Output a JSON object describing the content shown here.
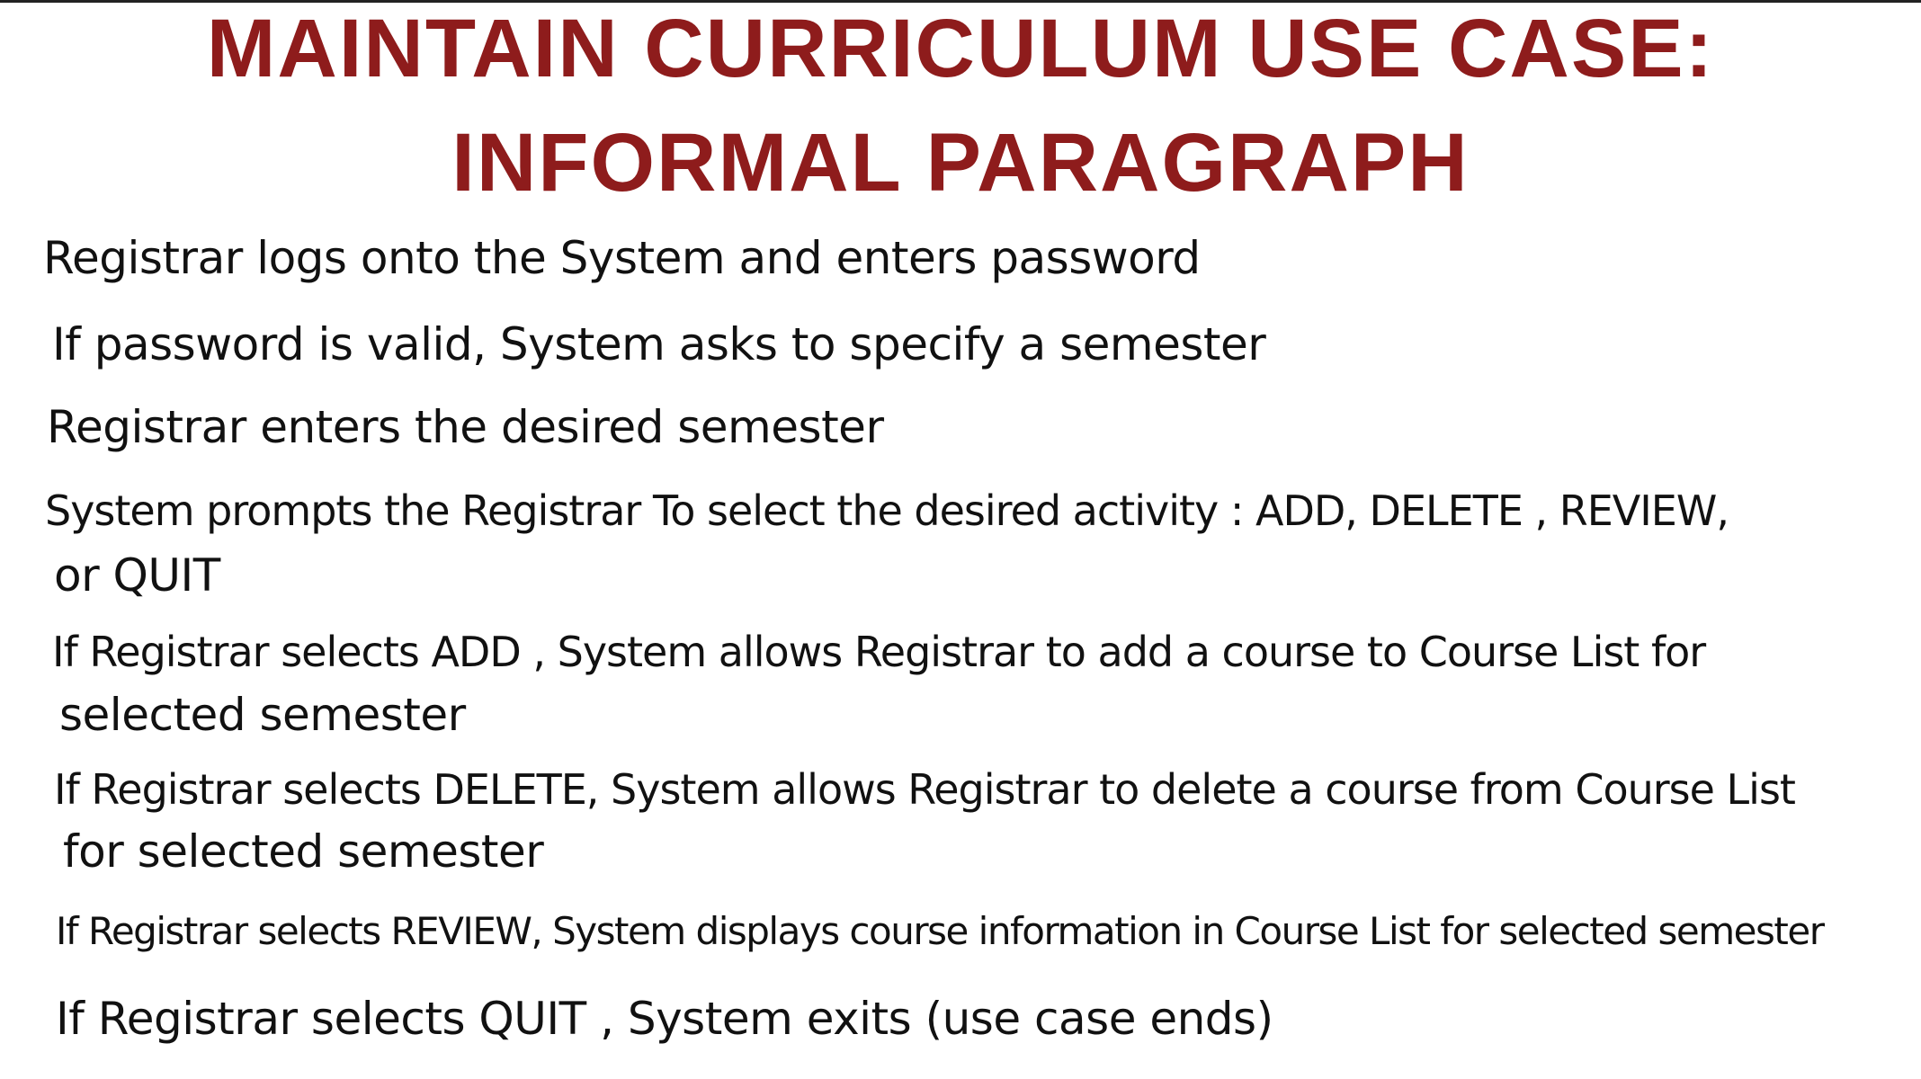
{
  "title": {
    "line1": "MAINTAIN CURRICULUM USE CASE:",
    "line2": "INFORMAL PARAGRAPH"
  },
  "paragraph": [
    "Registrar logs onto the System and enters password",
    "If password is valid, System asks to specify a semester",
    "Registrar enters the desired semester",
    "System prompts the Registrar To select the desired activity : ADD, DELETE , REVIEW,",
    "or QUIT",
    "If Registrar selects ADD , System allows Registrar to add a course to Course List  for",
    "selected semester",
    "If Registrar selects DELETE, System allows Registrar to delete a course from Course List",
    "for selected semester",
    "If Registrar selects REVIEW, System displays course  information in Course List for selected semester",
    "If Registrar selects QUIT , System exits (use case ends)"
  ],
  "colors": {
    "title": "#8e1c1c",
    "text": "#111111"
  }
}
